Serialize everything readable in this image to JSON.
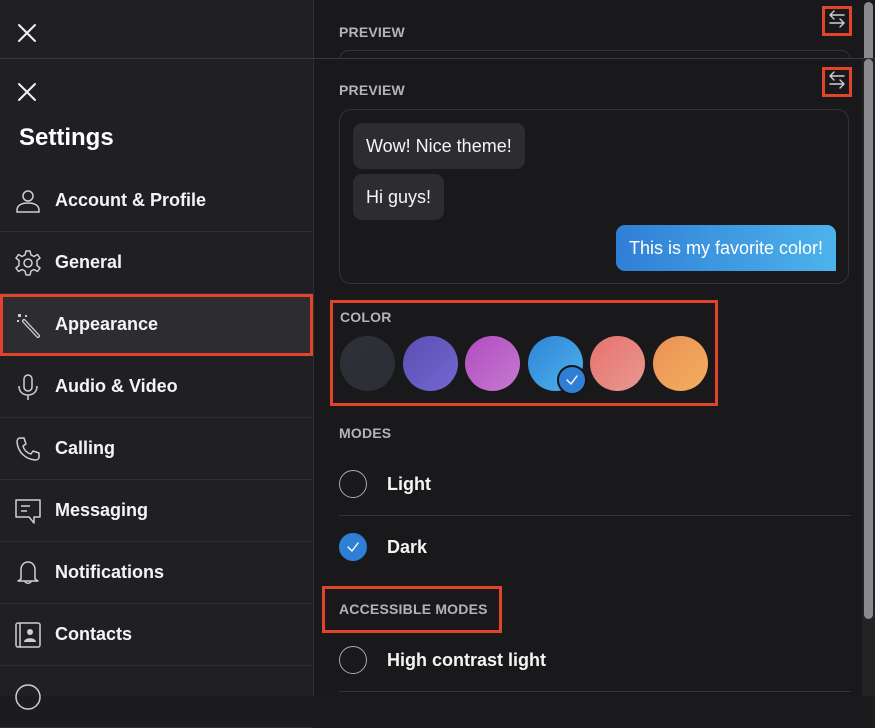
{
  "sidebar": {
    "title": "Settings",
    "close_icon": "close-icon",
    "items": [
      {
        "label": "Account & Profile",
        "icon": "person-icon",
        "active": false
      },
      {
        "label": "General",
        "icon": "gear-icon",
        "active": false
      },
      {
        "label": "Appearance",
        "icon": "magic-wand-icon",
        "active": true
      },
      {
        "label": "Audio & Video",
        "icon": "microphone-icon",
        "active": false
      },
      {
        "label": "Calling",
        "icon": "phone-icon",
        "active": false
      },
      {
        "label": "Messaging",
        "icon": "message-icon",
        "active": false
      },
      {
        "label": "Notifications",
        "icon": "bell-icon",
        "active": false
      },
      {
        "label": "Contacts",
        "icon": "contacts-icon",
        "active": false
      }
    ]
  },
  "main": {
    "preview_label": "PREVIEW",
    "swap_icon": "swap-arrows-icon",
    "preview": {
      "messages": [
        {
          "text": "Wow! Nice theme!",
          "side": "incoming"
        },
        {
          "text": "Hi guys!",
          "side": "incoming"
        },
        {
          "text": "This is my favorite color!",
          "side": "outgoing"
        }
      ]
    },
    "color_label": "COLOR",
    "colors": [
      {
        "name": "slate",
        "from": "#2e3238",
        "to": "#2a2e34",
        "selected": false
      },
      {
        "name": "indigo",
        "from": "#5a4fb0",
        "to": "#7467d4",
        "selected": false
      },
      {
        "name": "orchid",
        "from": "#b04cc0",
        "to": "#c67ad0",
        "selected": false
      },
      {
        "name": "blue",
        "from": "#2f84d8",
        "to": "#4db3ec",
        "selected": true
      },
      {
        "name": "coral",
        "from": "#e8706e",
        "to": "#e89a90",
        "selected": false
      },
      {
        "name": "orange",
        "from": "#eb8f55",
        "to": "#f2b05e",
        "selected": false
      }
    ],
    "modes_label": "MODES",
    "modes": [
      {
        "label": "Light",
        "selected": false
      },
      {
        "label": "Dark",
        "selected": true
      }
    ],
    "accessible_modes_label": "ACCESSIBLE MODES",
    "accessible_modes": [
      {
        "label": "High contrast light",
        "selected": false
      }
    ]
  },
  "colors": {
    "accent": "#2f7fd6",
    "highlight": "#e0452c"
  }
}
